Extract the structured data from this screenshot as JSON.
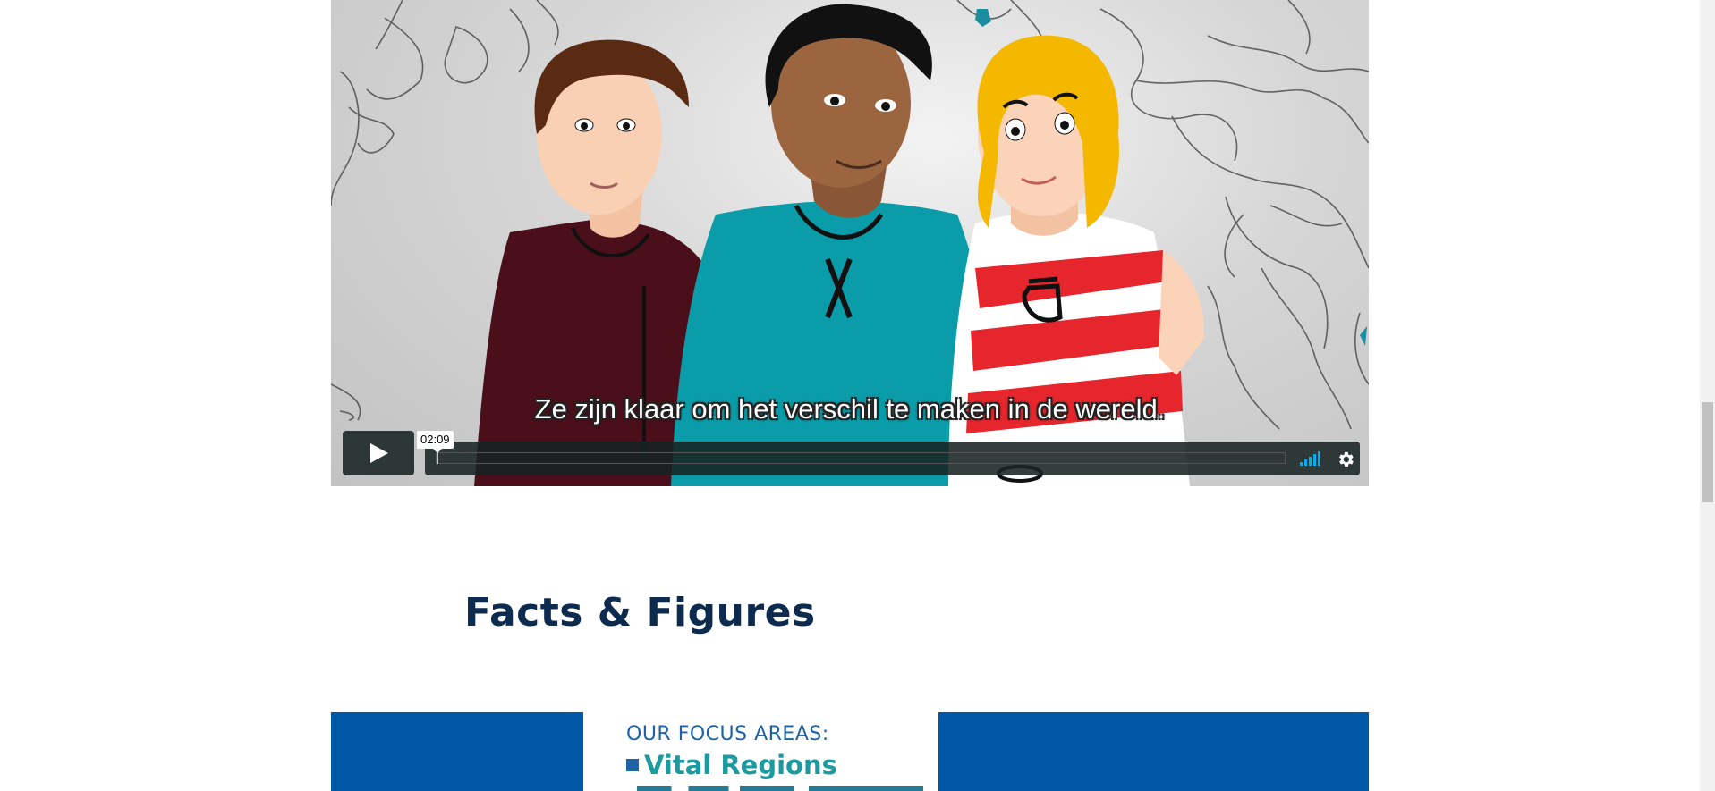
{
  "video": {
    "subtitle": "Ze zijn klaar om het verschil te maken in de wereld.",
    "time_tooltip": "02:09",
    "play_icon": "play-icon",
    "volume_icon": "volume-bars-icon",
    "settings_icon": "gear-icon",
    "accent_color": "#00adef",
    "progress": 0
  },
  "section": {
    "heading": "Facts & Figures"
  },
  "banner": {
    "background_color": "#0059a6",
    "focus_title": "OUR FOCUS AREAS:",
    "focus_item_1": "Vital Regions"
  },
  "colors": {
    "heading": "#0d2a4f",
    "focus_title": "#1d63a6",
    "focus_item": "#1c9aa0"
  }
}
